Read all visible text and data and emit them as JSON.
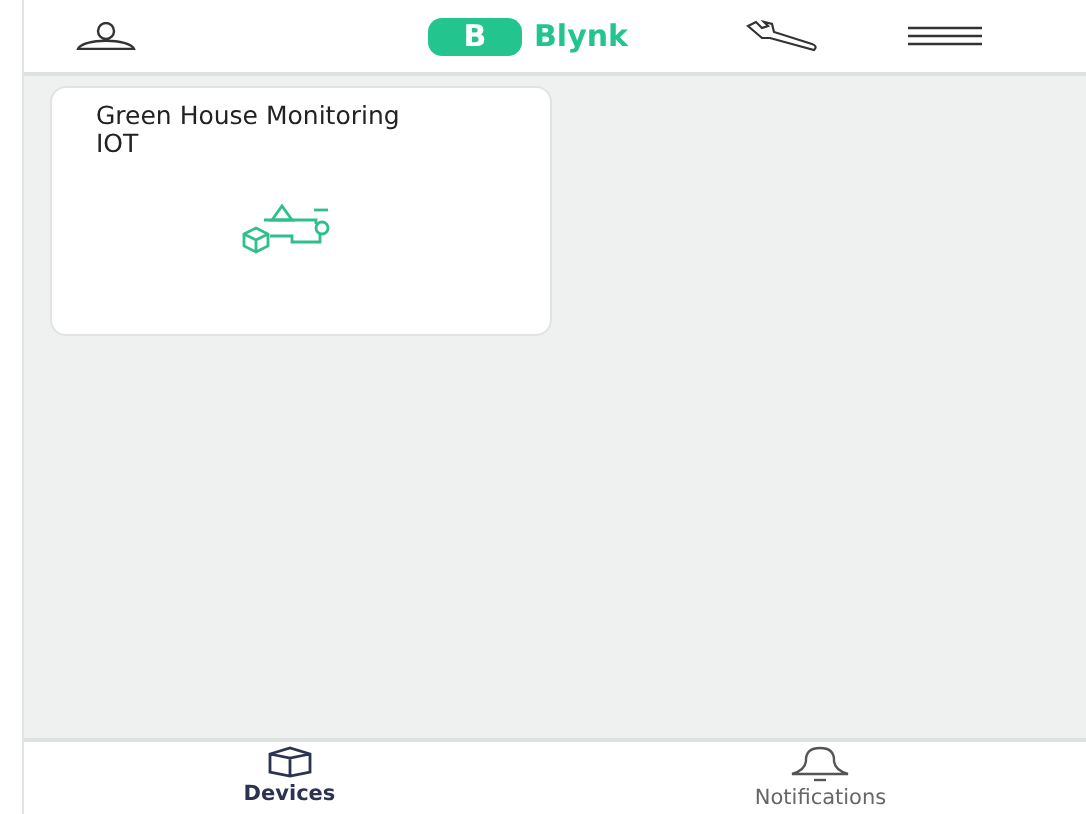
{
  "header": {
    "logo_letter": "B",
    "logo_text": "Blynk"
  },
  "devices": [
    {
      "name": "Green House Monitoring IOT"
    }
  ],
  "tabs": [
    {
      "label": "Devices",
      "selected": true,
      "kind": "devices"
    },
    {
      "label": "Notifications",
      "selected": false,
      "kind": "notifications"
    }
  ]
}
